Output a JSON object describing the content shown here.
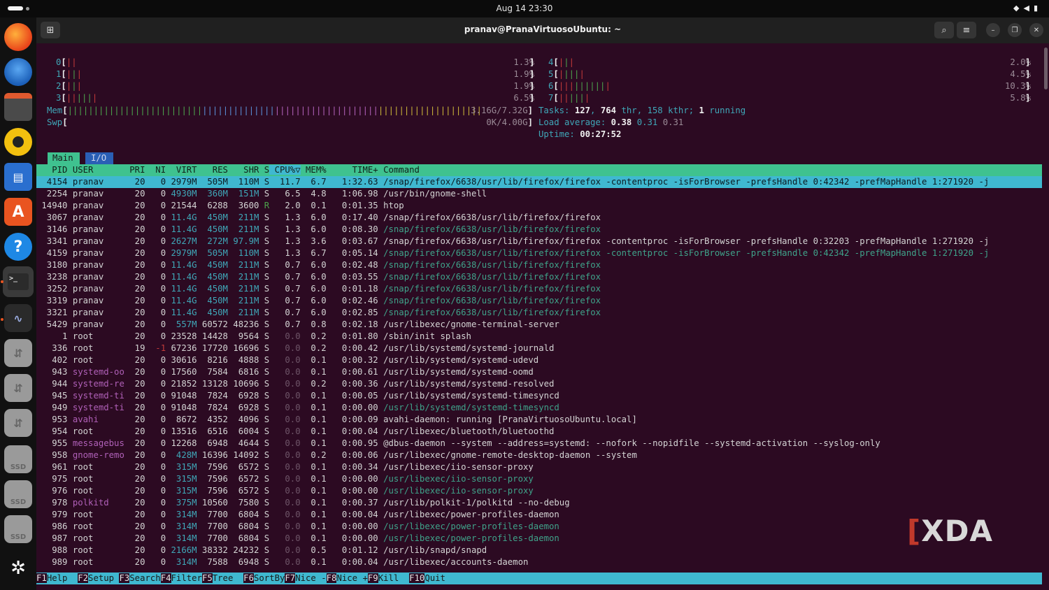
{
  "topbar": {
    "clock": "Aug 14  23:30",
    "tray_icons": [
      "wifi-icon",
      "volume-icon",
      "battery-icon"
    ]
  },
  "window": {
    "title": "pranav@PranaVirtuosoUbuntu: ~"
  },
  "meters": {
    "cpu": [
      {
        "id": "0",
        "bars": "||",
        "pct": "1.3%"
      },
      {
        "id": "1",
        "bars": "|||",
        "pct": "1.9%"
      },
      {
        "id": "2",
        "bars": "|||",
        "pct": "1.9%"
      },
      {
        "id": "3",
        "bars": "||||||",
        "pct": "6.5%"
      },
      {
        "id": "4",
        "bars": "|||",
        "pct": "2.0%"
      },
      {
        "id": "5",
        "bars": "|||||",
        "pct": "4.5%"
      },
      {
        "id": "6",
        "bars": "||||||||||",
        "pct": "10.3%"
      },
      {
        "id": "7",
        "bars": "||||||",
        "pct": "5.8%"
      }
    ],
    "mem_label": "Mem",
    "mem_value": "3.16G/7.32G",
    "swp_label": "Swp",
    "swp_value": "0K/4.00G",
    "tasks_prefix": "Tasks: ",
    "tasks": "127",
    "thr": "764",
    "kthr": "158",
    "running": "1",
    "load_label": "Load average: ",
    "load1": "0.38",
    "load5": "0.31",
    "load15": "0.31",
    "uptime_label": "Uptime: ",
    "uptime": "00:27:52"
  },
  "tabs": {
    "main": "Main",
    "io": "I/O"
  },
  "columns": [
    "PID",
    "USER",
    "PRI",
    "NI",
    "VIRT",
    "RES",
    "SHR",
    "S",
    "CPU%▽",
    "MEM%",
    "TIME+",
    "Command"
  ],
  "processes": [
    [
      "4154",
      "pranav",
      "20",
      "0",
      "2979M",
      "505M",
      "110M",
      "S",
      "11.7",
      "6.7",
      "1:32.63",
      "/snap/firefox/6638/usr/lib/firefox/firefox -contentproc -isForBrowser -prefsHandle 0:42342 -prefMapHandle 1:271920 -j"
    ],
    [
      "2254",
      "pranav",
      "20",
      "0",
      "4930M",
      "360M",
      "151M",
      "S",
      "6.5",
      "4.8",
      "1:06.98",
      "/usr/bin/gnome-shell"
    ],
    [
      "14940",
      "pranav",
      "20",
      "0",
      "21544",
      "6288",
      "3600",
      "R",
      "2.0",
      "0.1",
      "0:01.35",
      "htop"
    ],
    [
      "3067",
      "pranav",
      "20",
      "0",
      "11.4G",
      "450M",
      "211M",
      "S",
      "1.3",
      "6.0",
      "0:17.40",
      "/snap/firefox/6638/usr/lib/firefox/firefox"
    ],
    [
      "3146",
      "pranav",
      "20",
      "0",
      "11.4G",
      "450M",
      "211M",
      "S",
      "1.3",
      "6.0",
      "0:08.30",
      "/snap/firefox/6638/usr/lib/firefox/firefox"
    ],
    [
      "3341",
      "pranav",
      "20",
      "0",
      "2627M",
      "272M",
      "97.9M",
      "S",
      "1.3",
      "3.6",
      "0:03.67",
      "/snap/firefox/6638/usr/lib/firefox/firefox -contentproc -isForBrowser -prefsHandle 0:32203 -prefMapHandle 1:271920 -j"
    ],
    [
      "4159",
      "pranav",
      "20",
      "0",
      "2979M",
      "505M",
      "110M",
      "S",
      "1.3",
      "6.7",
      "0:05.14",
      "/snap/firefox/6638/usr/lib/firefox/firefox -contentproc -isForBrowser -prefsHandle 0:42342 -prefMapHandle 1:271920 -j"
    ],
    [
      "3180",
      "pranav",
      "20",
      "0",
      "11.4G",
      "450M",
      "211M",
      "S",
      "0.7",
      "6.0",
      "0:02.48",
      "/snap/firefox/6638/usr/lib/firefox/firefox"
    ],
    [
      "3238",
      "pranav",
      "20",
      "0",
      "11.4G",
      "450M",
      "211M",
      "S",
      "0.7",
      "6.0",
      "0:03.55",
      "/snap/firefox/6638/usr/lib/firefox/firefox"
    ],
    [
      "3252",
      "pranav",
      "20",
      "0",
      "11.4G",
      "450M",
      "211M",
      "S",
      "0.7",
      "6.0",
      "0:01.18",
      "/snap/firefox/6638/usr/lib/firefox/firefox"
    ],
    [
      "3319",
      "pranav",
      "20",
      "0",
      "11.4G",
      "450M",
      "211M",
      "S",
      "0.7",
      "6.0",
      "0:02.46",
      "/snap/firefox/6638/usr/lib/firefox/firefox"
    ],
    [
      "3321",
      "pranav",
      "20",
      "0",
      "11.4G",
      "450M",
      "211M",
      "S",
      "0.7",
      "6.0",
      "0:02.85",
      "/snap/firefox/6638/usr/lib/firefox/firefox"
    ],
    [
      "5429",
      "pranav",
      "20",
      "0",
      "557M",
      "60572",
      "48236",
      "S",
      "0.7",
      "0.8",
      "0:02.18",
      "/usr/libexec/gnome-terminal-server"
    ],
    [
      "1",
      "root",
      "20",
      "0",
      "23528",
      "14428",
      "9564",
      "S",
      "0.0",
      "0.2",
      "0:01.80",
      "/sbin/init splash"
    ],
    [
      "336",
      "root",
      "19",
      "-1",
      "67236",
      "17720",
      "16696",
      "S",
      "0.0",
      "0.2",
      "0:00.42",
      "/usr/lib/systemd/systemd-journald"
    ],
    [
      "402",
      "root",
      "20",
      "0",
      "30616",
      "8216",
      "4888",
      "S",
      "0.0",
      "0.1",
      "0:00.32",
      "/usr/lib/systemd/systemd-udevd"
    ],
    [
      "943",
      "systemd-oo",
      "20",
      "0",
      "17560",
      "7584",
      "6816",
      "S",
      "0.0",
      "0.1",
      "0:00.61",
      "/usr/lib/systemd/systemd-oomd"
    ],
    [
      "944",
      "systemd-re",
      "20",
      "0",
      "21852",
      "13128",
      "10696",
      "S",
      "0.0",
      "0.2",
      "0:00.36",
      "/usr/lib/systemd/systemd-resolved"
    ],
    [
      "945",
      "systemd-ti",
      "20",
      "0",
      "91048",
      "7824",
      "6928",
      "S",
      "0.0",
      "0.1",
      "0:00.05",
      "/usr/lib/systemd/systemd-timesyncd"
    ],
    [
      "949",
      "systemd-ti",
      "20",
      "0",
      "91048",
      "7824",
      "6928",
      "S",
      "0.0",
      "0.1",
      "0:00.00",
      "/usr/lib/systemd/systemd-timesyncd"
    ],
    [
      "953",
      "avahi",
      "20",
      "0",
      "8672",
      "4352",
      "4096",
      "S",
      "0.0",
      "0.1",
      "0:00.09",
      "avahi-daemon: running [PranaVirtuosoUbuntu.local]"
    ],
    [
      "954",
      "root",
      "20",
      "0",
      "13516",
      "6516",
      "6004",
      "S",
      "0.0",
      "0.1",
      "0:00.04",
      "/usr/libexec/bluetooth/bluetoothd"
    ],
    [
      "955",
      "messagebus",
      "20",
      "0",
      "12268",
      "6948",
      "4644",
      "S",
      "0.0",
      "0.1",
      "0:00.95",
      "@dbus-daemon --system --address=systemd: --nofork --nopidfile --systemd-activation --syslog-only"
    ],
    [
      "958",
      "gnome-remo",
      "20",
      "0",
      "428M",
      "16396",
      "14092",
      "S",
      "0.0",
      "0.2",
      "0:00.06",
      "/usr/libexec/gnome-remote-desktop-daemon --system"
    ],
    [
      "961",
      "root",
      "20",
      "0",
      "315M",
      "7596",
      "6572",
      "S",
      "0.0",
      "0.1",
      "0:00.34",
      "/usr/libexec/iio-sensor-proxy"
    ],
    [
      "975",
      "root",
      "20",
      "0",
      "315M",
      "7596",
      "6572",
      "S",
      "0.0",
      "0.1",
      "0:00.00",
      "/usr/libexec/iio-sensor-proxy"
    ],
    [
      "976",
      "root",
      "20",
      "0",
      "315M",
      "7596",
      "6572",
      "S",
      "0.0",
      "0.1",
      "0:00.00",
      "/usr/libexec/iio-sensor-proxy"
    ],
    [
      "978",
      "polkitd",
      "20",
      "0",
      "375M",
      "10560",
      "7580",
      "S",
      "0.0",
      "0.1",
      "0:00.37",
      "/usr/lib/polkit-1/polkitd --no-debug"
    ],
    [
      "979",
      "root",
      "20",
      "0",
      "314M",
      "7700",
      "6804",
      "S",
      "0.0",
      "0.1",
      "0:00.04",
      "/usr/libexec/power-profiles-daemon"
    ],
    [
      "986",
      "root",
      "20",
      "0",
      "314M",
      "7700",
      "6804",
      "S",
      "0.0",
      "0.1",
      "0:00.00",
      "/usr/libexec/power-profiles-daemon"
    ],
    [
      "987",
      "root",
      "20",
      "0",
      "314M",
      "7700",
      "6804",
      "S",
      "0.0",
      "0.1",
      "0:00.00",
      "/usr/libexec/power-profiles-daemon"
    ],
    [
      "988",
      "root",
      "20",
      "0",
      "2166M",
      "38332",
      "24232",
      "S",
      "0.0",
      "0.5",
      "0:01.12",
      "/usr/lib/snapd/snapd"
    ],
    [
      "989",
      "root",
      "20",
      "0",
      "314M",
      "7588",
      "6948",
      "S",
      "0.0",
      "0.1",
      "0:00.04",
      "/usr/libexec/accounts-daemon"
    ]
  ],
  "thread_rows": [
    4,
    6,
    7,
    8,
    9,
    10,
    11,
    19,
    25,
    26,
    29,
    30
  ],
  "footer": [
    {
      "key": "F1",
      "label": "Help  "
    },
    {
      "key": "F2",
      "label": "Setup "
    },
    {
      "key": "F3",
      "label": "Search"
    },
    {
      "key": "F4",
      "label": "Filter"
    },
    {
      "key": "F5",
      "label": "Tree  "
    },
    {
      "key": "F6",
      "label": "SortBy"
    },
    {
      "key": "F7",
      "label": "Nice -"
    },
    {
      "key": "F8",
      "label": "Nice +"
    },
    {
      "key": "F9",
      "label": "Kill  "
    },
    {
      "key": "F10",
      "label": "Quit"
    }
  ],
  "watermark": "XDA",
  "dock": [
    "firefox-icon",
    "thunderbird-icon",
    "files-icon",
    "rhythmbox-icon",
    "libreoffice-writer-icon",
    "app-center-icon",
    "help-icon",
    "terminal-icon",
    "system-monitor-icon",
    "usb-drive-icon",
    "usb-drive-icon",
    "usb-drive-icon",
    "ssd-drive-icon",
    "ssd-drive-icon",
    "ssd-drive-icon",
    "ubuntu-logo-icon"
  ],
  "dock_ssd_label": "SSD"
}
